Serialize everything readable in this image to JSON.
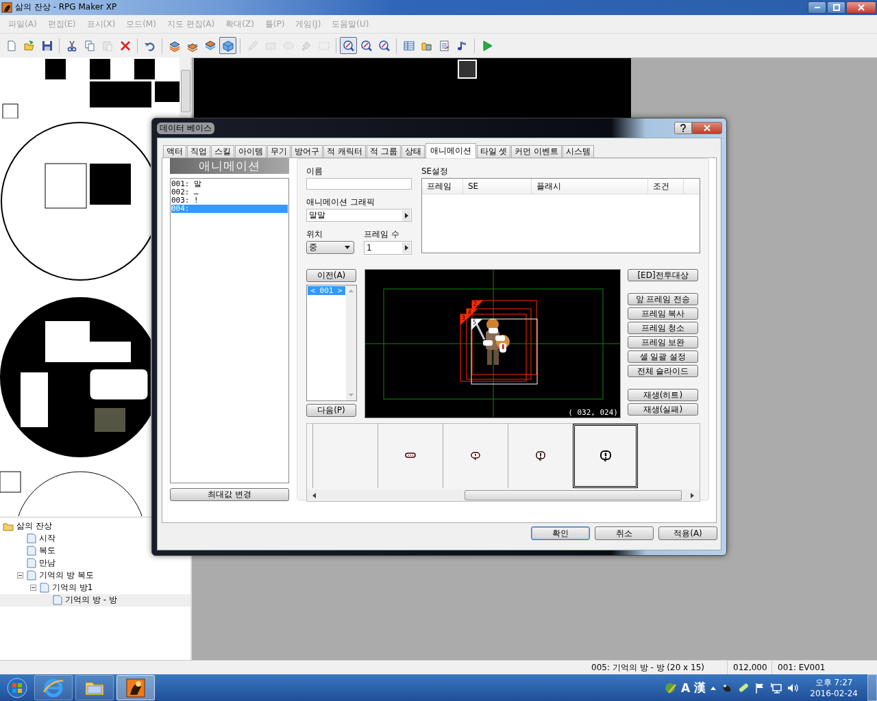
{
  "window": {
    "title": "삶의 잔상 - RPG Maker XP"
  },
  "menu": {
    "disabled": true,
    "items": [
      "파일(A)",
      "편집(E)",
      "표시(X)",
      "모드(M)",
      "지도 편집(A)",
      "확대(Z)",
      "툴(P)",
      "게임(J)",
      "도움말(U)"
    ]
  },
  "toolbar": [
    {
      "kind": "new",
      "selected": false,
      "disabled": false
    },
    {
      "kind": "open",
      "selected": false,
      "disabled": false
    },
    {
      "kind": "save",
      "selected": false,
      "disabled": false
    },
    {
      "kind": "sep"
    },
    {
      "kind": "cut",
      "selected": false,
      "disabled": false
    },
    {
      "kind": "copy",
      "selected": false,
      "disabled": false
    },
    {
      "kind": "paste",
      "selected": false,
      "disabled": true
    },
    {
      "kind": "delete",
      "selected": false,
      "disabled": false
    },
    {
      "kind": "sep"
    },
    {
      "kind": "undo",
      "selected": false,
      "disabled": false
    },
    {
      "kind": "sep"
    },
    {
      "kind": "layer1",
      "selected": false,
      "disabled": false
    },
    {
      "kind": "layer2",
      "selected": false,
      "disabled": false
    },
    {
      "kind": "layer3",
      "selected": false,
      "disabled": false
    },
    {
      "kind": "events",
      "selected": true,
      "disabled": false
    },
    {
      "kind": "sep"
    },
    {
      "kind": "pencil",
      "selected": false,
      "disabled": true
    },
    {
      "kind": "rect",
      "selected": false,
      "disabled": true
    },
    {
      "kind": "ellipse",
      "selected": false,
      "disabled": true
    },
    {
      "kind": "fill",
      "selected": false,
      "disabled": true
    },
    {
      "kind": "select",
      "selected": false,
      "disabled": true
    },
    {
      "kind": "sep"
    },
    {
      "kind": "zoom",
      "selected": true,
      "disabled": false
    },
    {
      "kind": "zoom",
      "selected": false,
      "disabled": false
    },
    {
      "kind": "zoom",
      "selected": false,
      "disabled": false
    },
    {
      "kind": "sep"
    },
    {
      "kind": "database",
      "selected": false,
      "disabled": false
    },
    {
      "kind": "materials",
      "selected": false,
      "disabled": false
    },
    {
      "kind": "script",
      "selected": false,
      "disabled": false
    },
    {
      "kind": "sound",
      "selected": false,
      "disabled": false
    },
    {
      "kind": "sep"
    },
    {
      "kind": "play",
      "selected": false,
      "disabled": false
    }
  ],
  "map_tree": [
    {
      "label": "삶의 잔상",
      "kind": "folder",
      "selected": false,
      "children": [
        {
          "label": "시작",
          "kind": "map",
          "selected": false
        },
        {
          "label": "복도",
          "kind": "map",
          "selected": false
        },
        {
          "label": "만남",
          "kind": "map",
          "selected": false
        },
        {
          "label": "기억의 방 복도",
          "kind": "map",
          "selected": false,
          "expanded": true,
          "children": [
            {
              "label": "기억의 방1",
              "kind": "map",
              "selected": false,
              "expanded": true,
              "children": [
                {
                  "label": "기억의 방 - 방",
                  "kind": "map",
                  "selected": true
                }
              ]
            }
          ]
        }
      ]
    }
  ],
  "status_bar": [
    "005: 기억의 방 - 방 (20 x 15)",
    "012,000",
    "001: EV001"
  ],
  "dialog": {
    "title": "데이터 베이스",
    "tabs": [
      {
        "label": "액터",
        "selected": false
      },
      {
        "label": "직업",
        "selected": false
      },
      {
        "label": "스킬",
        "selected": false
      },
      {
        "label": "아이템",
        "selected": false
      },
      {
        "label": "무기",
        "selected": false
      },
      {
        "label": "방어구",
        "selected": false
      },
      {
        "label": "적 캐릭터",
        "selected": false
      },
      {
        "label": "적 그룹",
        "selected": false
      },
      {
        "label": "상태",
        "selected": false
      },
      {
        "label": "애니메이션",
        "selected": true
      },
      {
        "label": "타일 셋",
        "selected": false
      },
      {
        "label": "커먼 이벤트",
        "selected": false
      },
      {
        "label": "시스템",
        "selected": false
      }
    ],
    "list_header": "애니메이션",
    "animations": [
      {
        "label": "001: 말",
        "selected": false
      },
      {
        "label": "002: …",
        "selected": false
      },
      {
        "label": "003: !",
        "selected": false
      },
      {
        "label": "004:",
        "selected": true
      }
    ],
    "max_button": "최대값 변경",
    "name_label": "이름",
    "graphic": {
      "label": "애니메이션 그래픽",
      "value": "말말"
    },
    "position": {
      "label": "위치",
      "value": "중"
    },
    "frame_count": {
      "label": "프레임 수",
      "value": "1"
    },
    "se": {
      "label": "SE설정",
      "columns": [
        "프레임",
        "SE",
        "플래시",
        "조건"
      ]
    },
    "prev_button": "이전(A)",
    "next_button": "다음(P)",
    "frames": [
      {
        "label": "< 001 >",
        "selected": true
      }
    ],
    "preview": {
      "coords": "( 032, 024)",
      "cells": [
        {
          "label": "2",
          "selected": false
        },
        {
          "label": "4",
          "selected": false
        },
        {
          "label": "3",
          "selected": false
        },
        {
          "label": "5",
          "selected": true
        }
      ]
    },
    "side_buttons": [
      [
        "[ED]전투대상"
      ],
      [
        "앞 프레임 전송",
        "프레임 복사",
        "프레임 청소",
        "프레임 보완",
        "셀 일괄 설정",
        "전체 슬라이드"
      ],
      [
        "재생(히트)",
        "재생(실패)"
      ]
    ],
    "strip": [
      {
        "kind": "empty",
        "selected": false
      },
      {
        "kind": "dots",
        "selected": false
      },
      {
        "kind": "bubble",
        "selected": false
      },
      {
        "kind": "exclaim-small",
        "selected": false
      },
      {
        "kind": "exclaim",
        "selected": true
      }
    ],
    "buttons": [
      {
        "label": "확인",
        "default": true
      },
      {
        "label": "취소",
        "default": false
      },
      {
        "label": "적용(A)",
        "default": false
      }
    ]
  },
  "taskbar": {
    "apps": [
      {
        "kind": "browser",
        "active": false
      },
      {
        "kind": "folder",
        "active": false
      },
      {
        "kind": "maker",
        "active": true
      }
    ],
    "ime": [
      "A",
      "漢"
    ],
    "time": "오후 7:27",
    "date": "2016-02-24"
  }
}
